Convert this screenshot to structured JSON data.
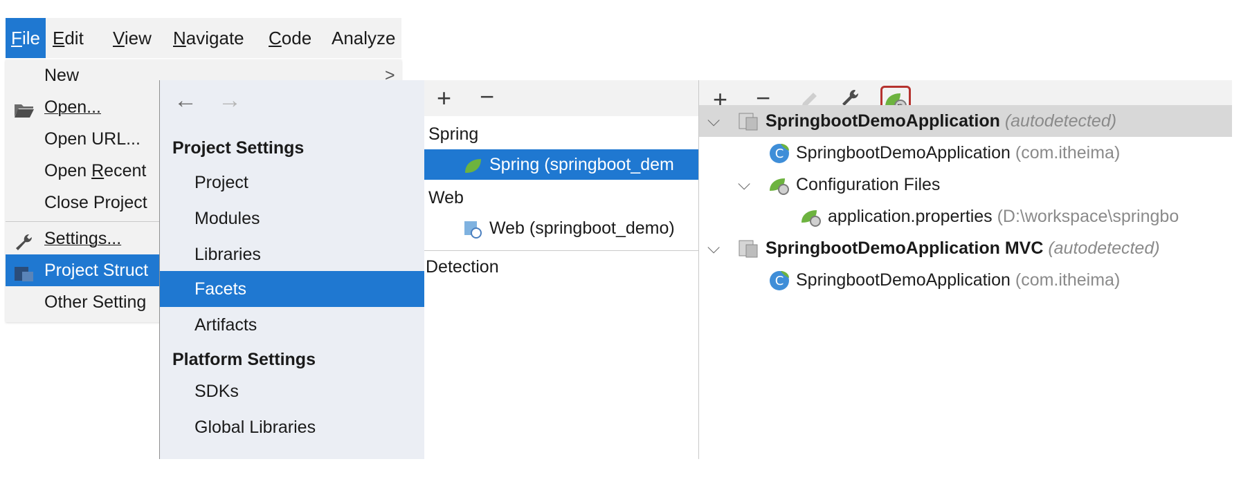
{
  "menubar": {
    "items": [
      {
        "mnemonic": "F",
        "rest": "ile"
      },
      {
        "mnemonic": "E",
        "rest": "dit"
      },
      {
        "mnemonic": "V",
        "rest": "iew"
      },
      {
        "mnemonic": "N",
        "rest": "avigate"
      },
      {
        "mnemonic": "C",
        "rest": "ode"
      },
      {
        "mnemonic": "",
        "rest": "Analyze"
      }
    ]
  },
  "file_menu": {
    "new": "New",
    "submenu_arrow": ">",
    "open": "Open...",
    "open_url": "Open URL...",
    "open_recent_pre": "Open ",
    "open_recent_mn": "R",
    "open_recent_post": "ecent",
    "close_project": "Close Project",
    "settings": "Settings...",
    "project_structure": "Project Struct",
    "other_settings": "Other Setting"
  },
  "nav": {
    "back": "←",
    "forward": "→",
    "project_settings_heading": "Project Settings",
    "items": [
      "Project",
      "Modules",
      "Libraries",
      "Facets",
      "Artifacts"
    ],
    "platform_settings_heading": "Platform Settings",
    "platform_items": [
      "SDKs",
      "Global Libraries"
    ]
  },
  "facets": {
    "add": "+",
    "remove": "−",
    "spring_group": "Spring",
    "spring_item": "Spring (springboot_dem",
    "web_group": "Web",
    "web_item": "Web (springboot_demo)",
    "detection": "Detection"
  },
  "right": {
    "add": "+",
    "remove": "−",
    "rows": {
      "ctx1_name": "SpringbootDemoApplication",
      "ctx1_tag": "(autodetected)",
      "class1_name": "SpringbootDemoApplication",
      "class1_pkg": "(com.itheima)",
      "config_files": "Configuration Files",
      "props_name": "application.properties",
      "props_path": "(D:\\workspace\\springbo",
      "ctx2_name": "SpringbootDemoApplication MVC",
      "ctx2_tag": "(autodetected)",
      "class2_name": "SpringbootDemoApplication",
      "class2_pkg": "(com.itheima)"
    }
  },
  "colors": {
    "selection": "#1f78d1",
    "spring_green": "#6db33f",
    "highlight_border": "#b5322e"
  }
}
